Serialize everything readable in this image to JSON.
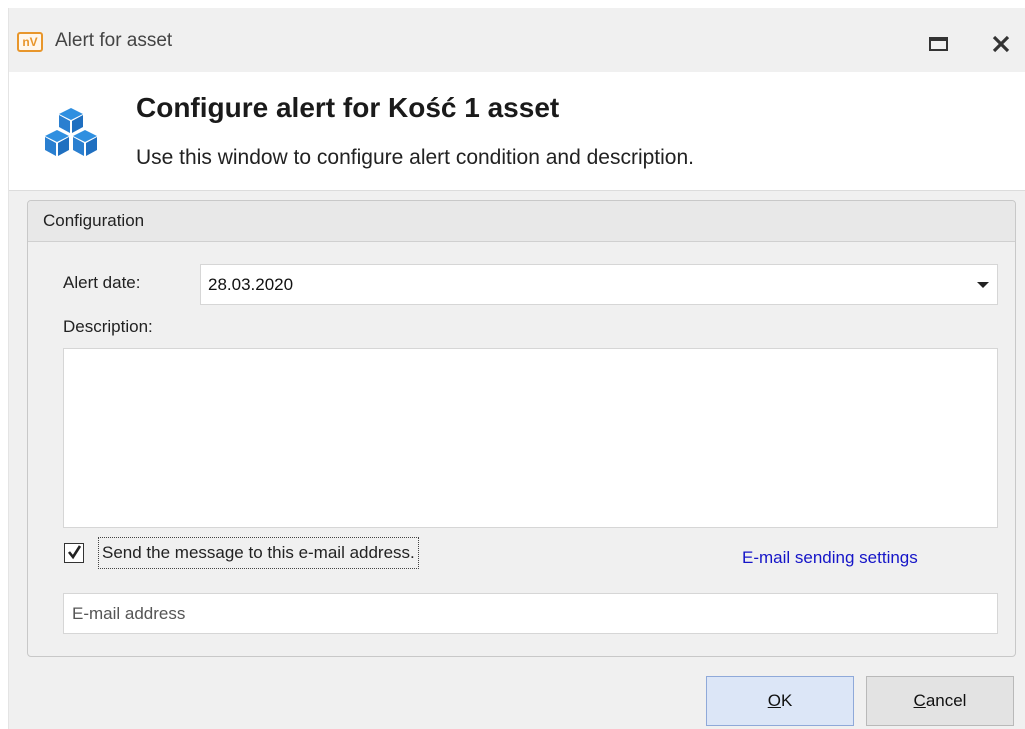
{
  "window": {
    "logo_text": "nV",
    "title": "Alert for asset"
  },
  "header": {
    "icon": "cubes-icon",
    "title": "Configure alert for Kość 1 asset",
    "subtitle": "Use this window to configure alert condition and description."
  },
  "configuration": {
    "group_title": "Configuration",
    "alert_date_label": "Alert date:",
    "alert_date_value": "28.03.2020",
    "description_label": "Description:",
    "description_value": "",
    "send_email_checked": true,
    "send_email_label": "Send the message to this e-mail address.",
    "email_settings_link": "E-mail sending settings",
    "email_placeholder": "E-mail address",
    "email_value": ""
  },
  "buttons": {
    "ok_mnemonic": "O",
    "ok_rest": "K",
    "cancel_mnemonic": "C",
    "cancel_rest": "ancel"
  },
  "colors": {
    "accent_logo": "#e8962b",
    "cube_icon": "#2f8fe0",
    "link": "#1515c8",
    "ok_button_bg": "#dce6f7"
  }
}
